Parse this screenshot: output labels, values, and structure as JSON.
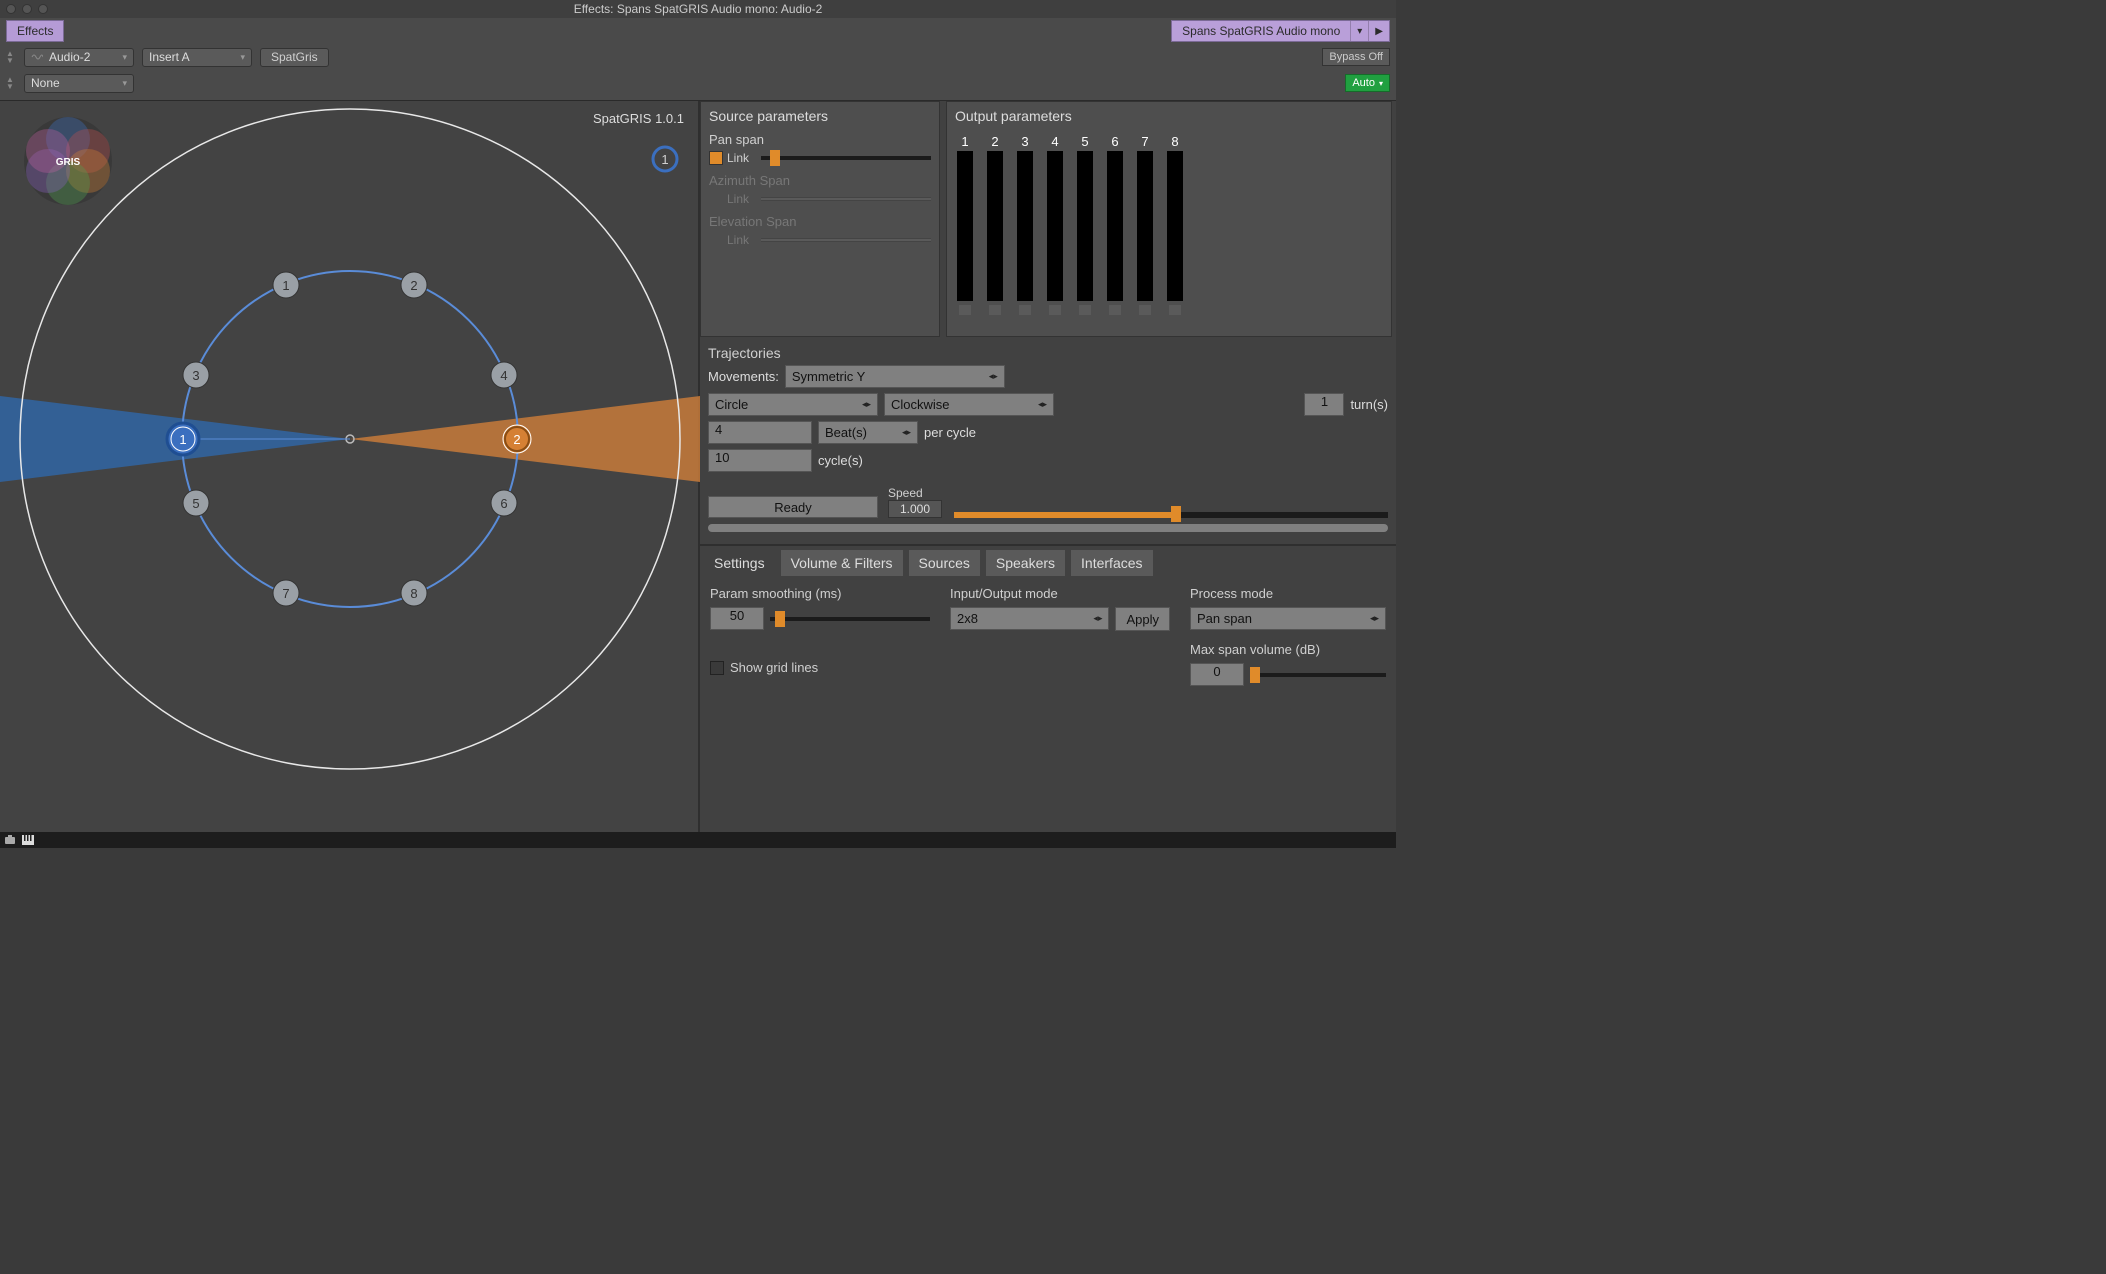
{
  "window": {
    "title": "Effects: Spans SpatGRIS Audio mono: Audio-2",
    "effects": "Effects",
    "plugin_selector": "Spans SpatGRIS Audio mono",
    "row1": {
      "audio": "Audio-2",
      "insert": "Insert A",
      "preset": "SpatGris",
      "bypass": "Bypass Off"
    },
    "row2": {
      "none": "None",
      "auto": "Auto"
    }
  },
  "spatial": {
    "title": "SpatGRIS 1.0.1",
    "logo": "GRIS",
    "corner_source": "1",
    "speakers": [
      "1",
      "2",
      "3",
      "4",
      "5",
      "6",
      "7",
      "8"
    ],
    "source_left": "1",
    "source_right": "2"
  },
  "source_params": {
    "header": "Source parameters",
    "pan_span": {
      "title": "Pan span",
      "link": "Link"
    },
    "azimuth": {
      "title": "Azimuth Span",
      "link": "Link"
    },
    "elevation": {
      "title": "Elevation Span",
      "link": "Link"
    }
  },
  "output_params": {
    "header": "Output parameters",
    "channels": [
      "1",
      "2",
      "3",
      "4",
      "5",
      "6",
      "7",
      "8"
    ]
  },
  "trajectories": {
    "header": "Trajectories",
    "movements_label": "Movements:",
    "movements": "Symmetric Y",
    "shape": "Circle",
    "direction": "Clockwise",
    "turns_value": "1",
    "turns_label": "turn(s)",
    "beats_value": "4",
    "beats_unit": "Beat(s)",
    "per_cycle": "per cycle",
    "cycles_value": "10",
    "cycles_label": "cycle(s)",
    "ready": "Ready",
    "speed_label": "Speed",
    "speed_value": "1.000"
  },
  "tabs": [
    "Settings",
    "Volume & Filters",
    "Sources",
    "Speakers",
    "Interfaces"
  ],
  "settings": {
    "param_smoothing_label": "Param smoothing (ms)",
    "param_smoothing_value": "50",
    "io_mode_label": "Input/Output mode",
    "io_mode_value": "2x8",
    "apply": "Apply",
    "process_mode_label": "Process mode",
    "process_mode_value": "Pan span",
    "max_span_label": "Max span volume (dB)",
    "max_span_value": "0",
    "show_grid": "Show grid lines"
  }
}
